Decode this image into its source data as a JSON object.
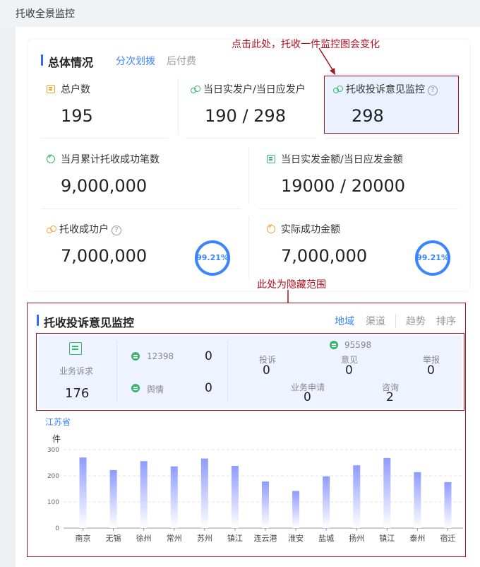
{
  "page": {
    "title": "托收全景监控"
  },
  "overview": {
    "title": "总体情况",
    "tabs": [
      "分次划拨",
      "后付费"
    ],
    "metrics": [
      {
        "label": "总户数",
        "value": "195",
        "icon": "document-icon"
      },
      {
        "label": "当日实发户/当日应发户",
        "value": "190 / 298",
        "icon": "users-icon"
      },
      {
        "label": "托收投诉意见监控",
        "value": "298",
        "icon": "users-icon"
      },
      {
        "label": "当月累计托收成功笔数",
        "value": "9,000,000",
        "icon": "coin-icon"
      },
      {
        "label": "当日实发金额/当日应发金额",
        "value": "19000 / 20000",
        "icon": "document-icon"
      },
      {
        "label": "托收成功户",
        "value": "7,000,000",
        "icon": "users-icon",
        "ring": "99.21%"
      },
      {
        "label": "实际成功金额",
        "value": "7,000,000",
        "icon": "coin-icon",
        "ring": "99.21%"
      }
    ],
    "ring_fraction": 0.9921
  },
  "annotations": {
    "top": "点击此处，托收一件监控图会变化",
    "middle": "此处为隐藏范围"
  },
  "complaint": {
    "title": "托收投诉意见监控",
    "tabs": [
      "地域",
      "渠道",
      "趋势",
      "排序"
    ],
    "business": {
      "label": "业务诉求",
      "value": "176"
    },
    "channels": [
      {
        "label": "12398",
        "value": "0"
      },
      {
        "label": "舆情",
        "value": "0"
      }
    ],
    "hotline": {
      "label": "95598",
      "items": [
        {
          "label": "投诉",
          "value": "0"
        },
        {
          "label": "意见",
          "value": "0"
        },
        {
          "label": "举报",
          "value": "0"
        },
        {
          "label": "业务申请",
          "value": "0"
        },
        {
          "label": "咨询",
          "value": "2"
        }
      ]
    }
  },
  "chart_data": {
    "type": "bar",
    "title": "江苏省",
    "ylabel": "件",
    "xlabel": "",
    "ylim": [
      0,
      300
    ],
    "yticks": [
      0,
      100,
      200,
      300
    ],
    "categories": [
      "南京",
      "无锡",
      "徐州",
      "常州",
      "苏州",
      "镇江",
      "连云港",
      "淮安",
      "盐城",
      "扬州",
      "镇江",
      "泰州",
      "宿迁"
    ],
    "values": [
      270,
      222,
      256,
      236,
      266,
      238,
      178,
      142,
      198,
      240,
      268,
      214,
      176
    ],
    "bar_gradient": [
      "#8f9bff",
      "#ffffff"
    ]
  }
}
